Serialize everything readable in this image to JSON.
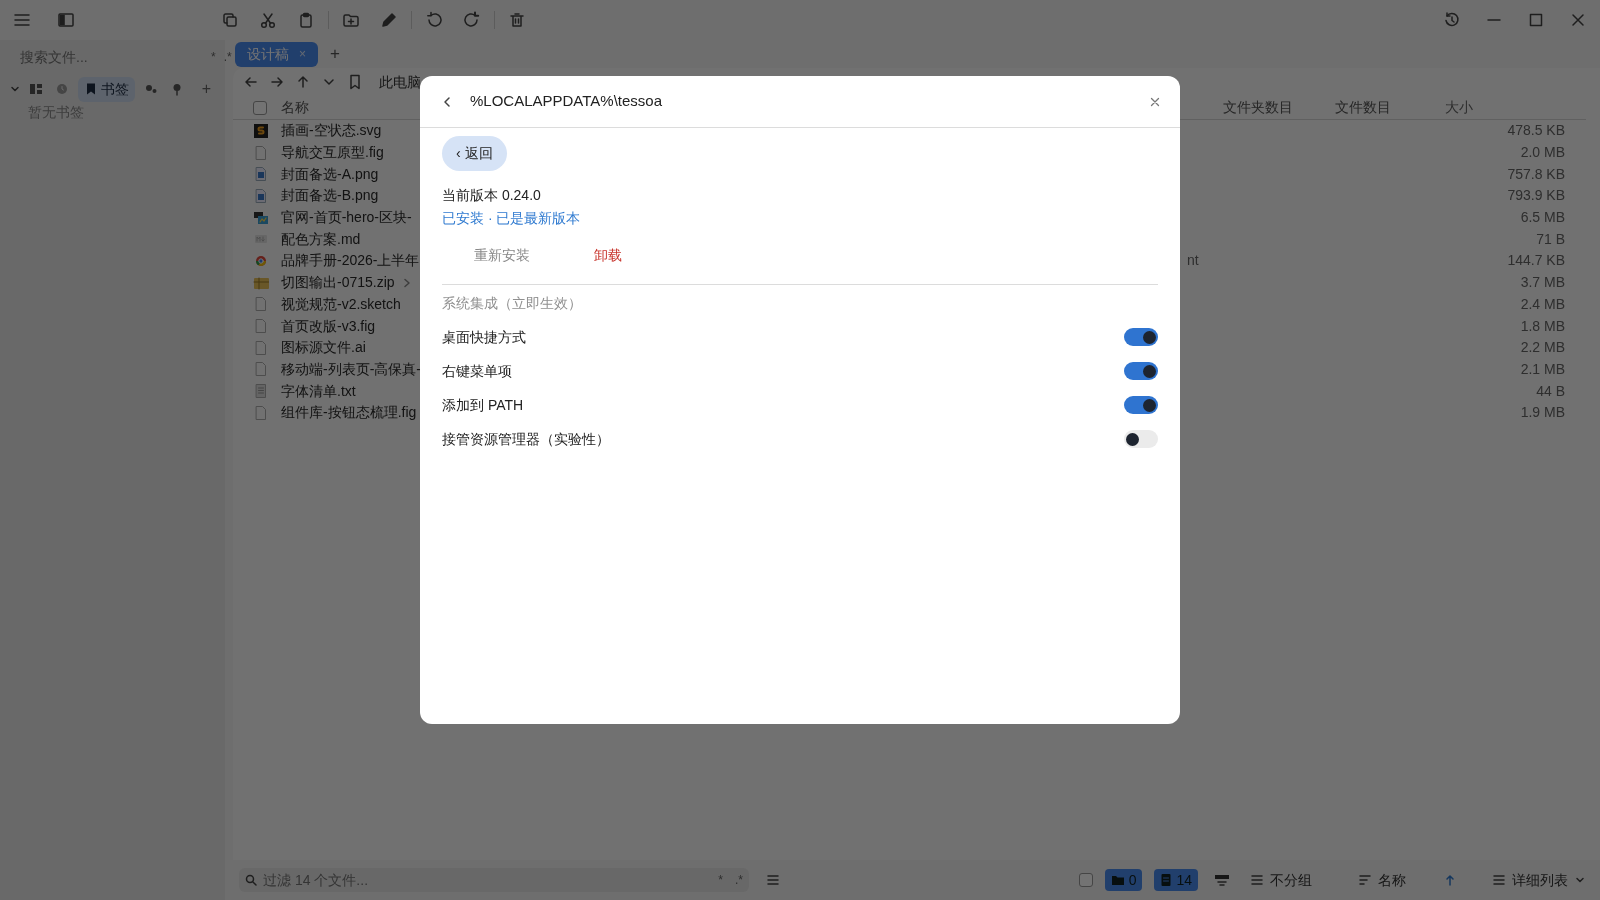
{
  "sidebar": {
    "search": {
      "placeholder": "搜索文件...",
      "toggles": [
        "*",
        ".*"
      ]
    },
    "views": [
      {
        "kind": "grid",
        "selected": false
      },
      {
        "kind": "clock",
        "selected": false
      },
      {
        "kind": "bookmark",
        "label": "书签",
        "selected": true
      },
      {
        "kind": "tags",
        "selected": false
      },
      {
        "kind": "pin",
        "selected": false
      }
    ],
    "add": "+",
    "empty_text": "暂无书签"
  },
  "tabs": [
    {
      "label": "设计稿",
      "close": "×",
      "selected": true
    }
  ],
  "new_tab": "+",
  "nav": {
    "breadcrumb": "此电脑"
  },
  "table": {
    "select_all_checked": false,
    "columns": [
      "名称",
      "文件夹数目",
      "文件数目",
      "大小"
    ],
    "rows": [
      {
        "name": "插画-空状态.svg",
        "kind": "vector",
        "expandable": false,
        "size": "478.5 KB"
      },
      {
        "name": "导航交互原型.fig",
        "kind": "file",
        "expandable": false,
        "size": "2.0 MB"
      },
      {
        "name": "封面备选-A.png",
        "kind": "image",
        "expandable": false,
        "size": "757.8 KB"
      },
      {
        "name": "封面备选-B.png",
        "kind": "image",
        "expandable": false,
        "size": "793.9 KB"
      },
      {
        "name": "官网-首页-hero-区块-",
        "kind": "web",
        "expandable": false,
        "size": "6.5 MB"
      },
      {
        "name": "配色方案.md",
        "kind": "markdown",
        "expandable": false,
        "size": "71 B"
      },
      {
        "name": "品牌手册-2026-上半年",
        "kind": "browser",
        "expandable": false,
        "column_2": "nt",
        "size": "144.7 KB"
      },
      {
        "name": "切图输出-0715.zip",
        "kind": "archive",
        "expandable": true,
        "size": "3.7 MB"
      },
      {
        "name": "视觉规范-v2.sketch",
        "kind": "file",
        "expandable": false,
        "size": "2.4 MB"
      },
      {
        "name": "首页改版-v3.fig",
        "kind": "file",
        "expandable": false,
        "size": "1.8 MB"
      },
      {
        "name": "图标源文件.ai",
        "kind": "file",
        "expandable": false,
        "size": "2.2 MB"
      },
      {
        "name": "移动端-列表页-高保真-",
        "kind": "file",
        "expandable": false,
        "size": "2.1 MB"
      },
      {
        "name": "字体清单.txt",
        "kind": "text",
        "expandable": false,
        "size": "44 B"
      },
      {
        "name": "组件库-按钮态梳理.fig",
        "kind": "file",
        "expandable": false,
        "size": "1.9 MB"
      }
    ]
  },
  "dialog": {
    "path": "%LOCALAPPDATA%\\tessoa",
    "back_chevron": "‹",
    "back_button": "返回",
    "version": "当前版本 0.24.0",
    "status": "已安装 · 已是最新版本",
    "actions": [
      {
        "label": "重新安装",
        "kind": "neutral"
      },
      {
        "label": "卸载",
        "kind": "danger"
      }
    ],
    "section": "系统集成（立即生效）",
    "settings": [
      {
        "label": "桌面快捷方式",
        "on": true
      },
      {
        "label": "右键菜单项",
        "on": true
      },
      {
        "label": "添加到 PATH",
        "on": true
      },
      {
        "label": "接管资源管理器（实验性）",
        "on": false
      }
    ]
  },
  "status_bar": {
    "select_checked": false,
    "filter_placeholder": "过滤 14 个文件...",
    "filter_toggles": [
      "*",
      ".*"
    ],
    "folders": "0",
    "files": "14",
    "group": "不分组",
    "sort": "名称",
    "view": "详细列表"
  }
}
